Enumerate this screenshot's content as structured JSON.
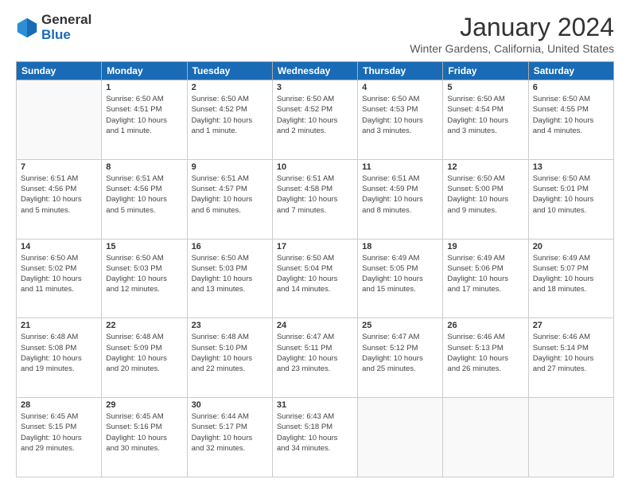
{
  "logo": {
    "general": "General",
    "blue": "Blue"
  },
  "title": "January 2024",
  "location": "Winter Gardens, California, United States",
  "header_days": [
    "Sunday",
    "Monday",
    "Tuesday",
    "Wednesday",
    "Thursday",
    "Friday",
    "Saturday"
  ],
  "weeks": [
    [
      {
        "day": "",
        "info": ""
      },
      {
        "day": "1",
        "info": "Sunrise: 6:50 AM\nSunset: 4:51 PM\nDaylight: 10 hours\nand 1 minute."
      },
      {
        "day": "2",
        "info": "Sunrise: 6:50 AM\nSunset: 4:52 PM\nDaylight: 10 hours\nand 1 minute."
      },
      {
        "day": "3",
        "info": "Sunrise: 6:50 AM\nSunset: 4:52 PM\nDaylight: 10 hours\nand 2 minutes."
      },
      {
        "day": "4",
        "info": "Sunrise: 6:50 AM\nSunset: 4:53 PM\nDaylight: 10 hours\nand 3 minutes."
      },
      {
        "day": "5",
        "info": "Sunrise: 6:50 AM\nSunset: 4:54 PM\nDaylight: 10 hours\nand 3 minutes."
      },
      {
        "day": "6",
        "info": "Sunrise: 6:50 AM\nSunset: 4:55 PM\nDaylight: 10 hours\nand 4 minutes."
      }
    ],
    [
      {
        "day": "7",
        "info": "Sunrise: 6:51 AM\nSunset: 4:56 PM\nDaylight: 10 hours\nand 5 minutes."
      },
      {
        "day": "8",
        "info": "Sunrise: 6:51 AM\nSunset: 4:56 PM\nDaylight: 10 hours\nand 5 minutes."
      },
      {
        "day": "9",
        "info": "Sunrise: 6:51 AM\nSunset: 4:57 PM\nDaylight: 10 hours\nand 6 minutes."
      },
      {
        "day": "10",
        "info": "Sunrise: 6:51 AM\nSunset: 4:58 PM\nDaylight: 10 hours\nand 7 minutes."
      },
      {
        "day": "11",
        "info": "Sunrise: 6:51 AM\nSunset: 4:59 PM\nDaylight: 10 hours\nand 8 minutes."
      },
      {
        "day": "12",
        "info": "Sunrise: 6:50 AM\nSunset: 5:00 PM\nDaylight: 10 hours\nand 9 minutes."
      },
      {
        "day": "13",
        "info": "Sunrise: 6:50 AM\nSunset: 5:01 PM\nDaylight: 10 hours\nand 10 minutes."
      }
    ],
    [
      {
        "day": "14",
        "info": "Sunrise: 6:50 AM\nSunset: 5:02 PM\nDaylight: 10 hours\nand 11 minutes."
      },
      {
        "day": "15",
        "info": "Sunrise: 6:50 AM\nSunset: 5:03 PM\nDaylight: 10 hours\nand 12 minutes."
      },
      {
        "day": "16",
        "info": "Sunrise: 6:50 AM\nSunset: 5:03 PM\nDaylight: 10 hours\nand 13 minutes."
      },
      {
        "day": "17",
        "info": "Sunrise: 6:50 AM\nSunset: 5:04 PM\nDaylight: 10 hours\nand 14 minutes."
      },
      {
        "day": "18",
        "info": "Sunrise: 6:49 AM\nSunset: 5:05 PM\nDaylight: 10 hours\nand 15 minutes."
      },
      {
        "day": "19",
        "info": "Sunrise: 6:49 AM\nSunset: 5:06 PM\nDaylight: 10 hours\nand 17 minutes."
      },
      {
        "day": "20",
        "info": "Sunrise: 6:49 AM\nSunset: 5:07 PM\nDaylight: 10 hours\nand 18 minutes."
      }
    ],
    [
      {
        "day": "21",
        "info": "Sunrise: 6:48 AM\nSunset: 5:08 PM\nDaylight: 10 hours\nand 19 minutes."
      },
      {
        "day": "22",
        "info": "Sunrise: 6:48 AM\nSunset: 5:09 PM\nDaylight: 10 hours\nand 20 minutes."
      },
      {
        "day": "23",
        "info": "Sunrise: 6:48 AM\nSunset: 5:10 PM\nDaylight: 10 hours\nand 22 minutes."
      },
      {
        "day": "24",
        "info": "Sunrise: 6:47 AM\nSunset: 5:11 PM\nDaylight: 10 hours\nand 23 minutes."
      },
      {
        "day": "25",
        "info": "Sunrise: 6:47 AM\nSunset: 5:12 PM\nDaylight: 10 hours\nand 25 minutes."
      },
      {
        "day": "26",
        "info": "Sunrise: 6:46 AM\nSunset: 5:13 PM\nDaylight: 10 hours\nand 26 minutes."
      },
      {
        "day": "27",
        "info": "Sunrise: 6:46 AM\nSunset: 5:14 PM\nDaylight: 10 hours\nand 27 minutes."
      }
    ],
    [
      {
        "day": "28",
        "info": "Sunrise: 6:45 AM\nSunset: 5:15 PM\nDaylight: 10 hours\nand 29 minutes."
      },
      {
        "day": "29",
        "info": "Sunrise: 6:45 AM\nSunset: 5:16 PM\nDaylight: 10 hours\nand 30 minutes."
      },
      {
        "day": "30",
        "info": "Sunrise: 6:44 AM\nSunset: 5:17 PM\nDaylight: 10 hours\nand 32 minutes."
      },
      {
        "day": "31",
        "info": "Sunrise: 6:43 AM\nSunset: 5:18 PM\nDaylight: 10 hours\nand 34 minutes."
      },
      {
        "day": "",
        "info": ""
      },
      {
        "day": "",
        "info": ""
      },
      {
        "day": "",
        "info": ""
      }
    ]
  ]
}
